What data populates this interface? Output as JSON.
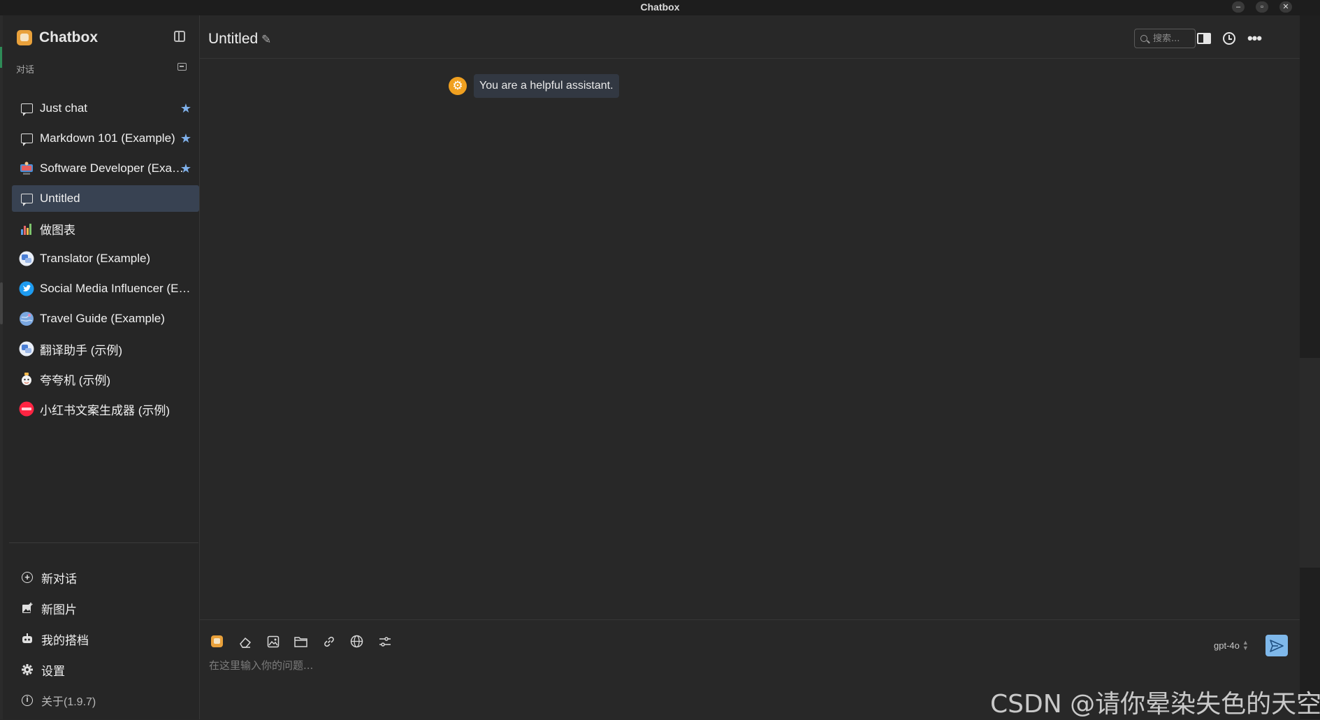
{
  "window": {
    "title": "Chatbox",
    "controls": [
      "–",
      "▫",
      "✕"
    ]
  },
  "sidebar": {
    "app_name": "Chatbox",
    "section_label": "对话",
    "sessions": [
      {
        "label": "Just chat",
        "icon": "chat-bubble-icon",
        "starred": true,
        "star": "★",
        "active": false
      },
      {
        "label": "Markdown 101 (Example)",
        "icon": "chat-bubble-icon",
        "starred": true,
        "star": "★",
        "active": false
      },
      {
        "label": "Software Developer (Example)",
        "icon": "developer-avatar-icon",
        "starred": true,
        "star": "★",
        "active": false
      },
      {
        "label": "Untitled",
        "icon": "chat-bubble-icon",
        "starred": false,
        "active": true
      },
      {
        "label": "做图表",
        "icon": "chart-avatar-icon",
        "starred": false,
        "active": false
      },
      {
        "label": "Translator (Example)",
        "icon": "translator-avatar-icon",
        "starred": false,
        "active": false
      },
      {
        "label": "Social Media Influencer (Example)",
        "icon": "twitter-avatar-icon",
        "starred": false,
        "active": false
      },
      {
        "label": "Travel Guide (Example)",
        "icon": "globe-avatar-icon",
        "starred": false,
        "active": false
      },
      {
        "label": "翻译助手 (示例)",
        "icon": "translator-avatar-icon",
        "starred": false,
        "active": false
      },
      {
        "label": "夸夸机 (示例)",
        "icon": "mascot-avatar-icon",
        "starred": false,
        "active": false
      },
      {
        "label": "小红书文案生成器 (示例)",
        "icon": "xiaohongshu-avatar-icon",
        "starred": false,
        "active": false
      }
    ],
    "bottom_menu": {
      "new_chat": "新对话",
      "new_image": "新图片",
      "my_copilots": "我的搭档",
      "settings": "设置",
      "about": "关于(1.9.7)"
    }
  },
  "header": {
    "chat_title": "Untitled",
    "search_placeholder": "搜索..."
  },
  "messages": [
    {
      "role": "system",
      "text": "You are a helpful assistant."
    }
  ],
  "composer": {
    "placeholder": "在这里输入你的问题...",
    "model": "gpt-4o",
    "tools": [
      "chatbox-logo-icon",
      "eraser-icon",
      "image-icon",
      "folder-icon",
      "link-icon",
      "globe-icon",
      "settings-sliders-icon"
    ]
  },
  "watermark": "CSDN @请你晕染失色的天空",
  "colors": {
    "background": "#282828",
    "sidebar": "#262626",
    "active_item": "#384252",
    "accent": "#7fb8ea",
    "system_avatar": "#f0a020",
    "brand": "#e9a13b"
  }
}
